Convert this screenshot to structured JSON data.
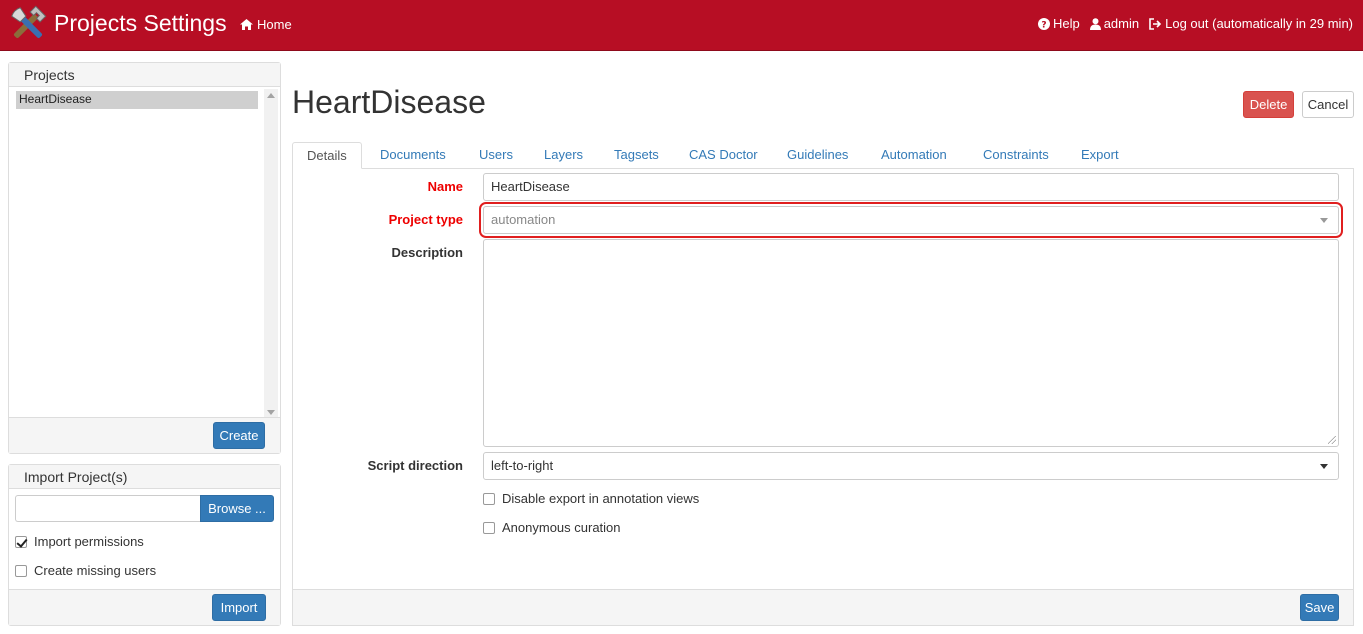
{
  "header": {
    "app_title": "Projects Settings",
    "home_label": "Home",
    "help_label": "Help",
    "user_label": "admin",
    "logout_label": "Log out (automatically in 29 min)",
    "brand_color": "#b70e24"
  },
  "sidebar": {
    "projects_heading": "Projects",
    "projects": [
      "HeartDisease"
    ],
    "selected_project": "HeartDisease",
    "create_label": "Create",
    "import_heading": "Import Project(s)",
    "browse_label": "Browse ...",
    "import_permissions_label": "Import permissions",
    "import_permissions_checked": true,
    "create_missing_users_label": "Create missing users",
    "create_missing_users_checked": false,
    "import_label": "Import"
  },
  "main": {
    "title": "HeartDisease",
    "delete_label": "Delete",
    "cancel_label": "Cancel",
    "tabs": [
      {
        "label": "Details",
        "active": true
      },
      {
        "label": "Documents"
      },
      {
        "label": "Users"
      },
      {
        "label": "Layers"
      },
      {
        "label": "Tagsets"
      },
      {
        "label": "CAS Doctor"
      },
      {
        "label": "Guidelines"
      },
      {
        "label": "Automation"
      },
      {
        "label": "Constraints"
      },
      {
        "label": "Export"
      }
    ],
    "form": {
      "name_label": "Name",
      "name_value": "HeartDisease",
      "project_type_label": "Project type",
      "project_type_value": "automation",
      "description_label": "Description",
      "description_value": "",
      "script_direction_label": "Script direction",
      "script_direction_value": "left-to-right",
      "disable_export_label": "Disable export in annotation views",
      "disable_export_checked": false,
      "anonymous_curation_label": "Anonymous curation",
      "anonymous_curation_checked": false,
      "save_label": "Save"
    }
  }
}
